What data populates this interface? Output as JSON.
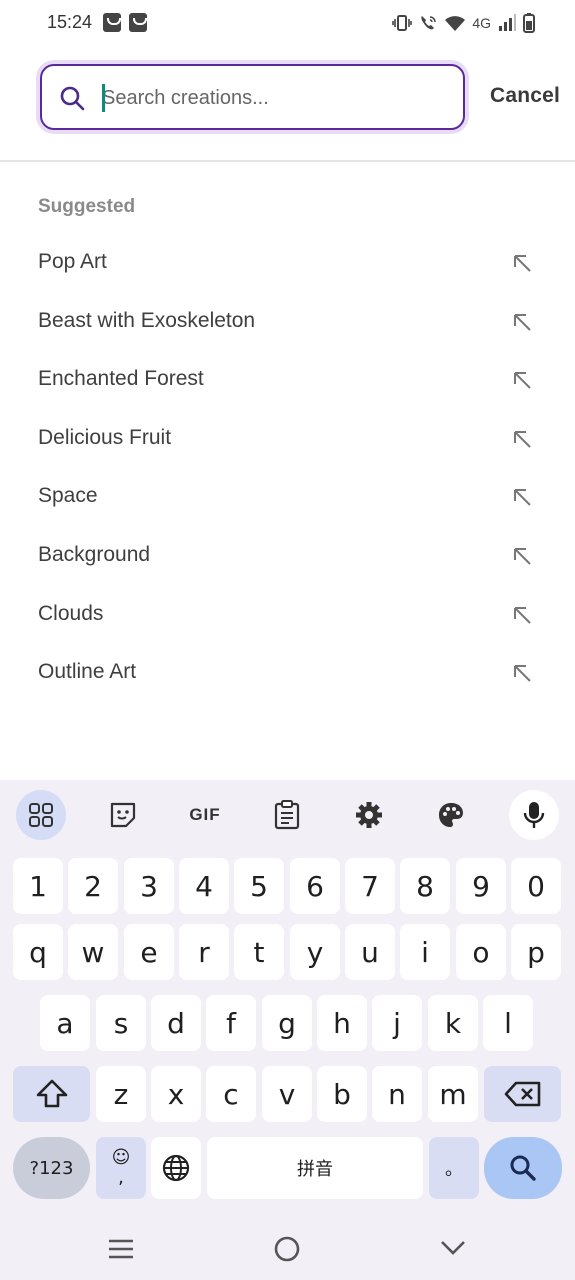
{
  "status_bar": {
    "time": "15:24",
    "network_label": "4G",
    "icons": [
      "notification-bag-icon",
      "notification-bag-icon",
      "vibrate-icon",
      "wifi-calling-icon",
      "wifi-icon",
      "signal-icon",
      "battery-icon"
    ]
  },
  "search": {
    "placeholder": "Search creations...",
    "value": "",
    "cancel_label": "Cancel",
    "border_color": "#5a2a9c"
  },
  "suggested": {
    "heading": "Suggested",
    "items": [
      {
        "label": "Pop Art"
      },
      {
        "label": "Beast with Exoskeleton"
      },
      {
        "label": "Enchanted Forest"
      },
      {
        "label": "Delicious Fruit"
      },
      {
        "label": "Space"
      },
      {
        "label": "Background"
      },
      {
        "label": "Clouds"
      },
      {
        "label": "Outline Art"
      }
    ]
  },
  "keyboard": {
    "toolbar": {
      "icons": [
        "apps-grid-icon",
        "sticker-icon",
        "gif-icon",
        "clipboard-icon",
        "settings-gear-icon",
        "palette-icon",
        "microphone-icon"
      ],
      "gif_label": "GIF"
    },
    "number_row": [
      "1",
      "2",
      "3",
      "4",
      "5",
      "6",
      "7",
      "8",
      "9",
      "0"
    ],
    "row1": [
      "q",
      "w",
      "e",
      "r",
      "t",
      "y",
      "u",
      "i",
      "o",
      "p"
    ],
    "row2": [
      "a",
      "s",
      "d",
      "f",
      "g",
      "h",
      "j",
      "k",
      "l"
    ],
    "row3": [
      "z",
      "x",
      "c",
      "v",
      "b",
      "n",
      "m"
    ],
    "symbols_label": "?123",
    "emoji_top": "☺",
    "emoji_bottom": ",",
    "space_label": "拼音",
    "period_label": "。",
    "action": "search-icon"
  },
  "nav_bar": {
    "icons": [
      "recent-apps-icon",
      "home-icon",
      "back-icon"
    ]
  }
}
